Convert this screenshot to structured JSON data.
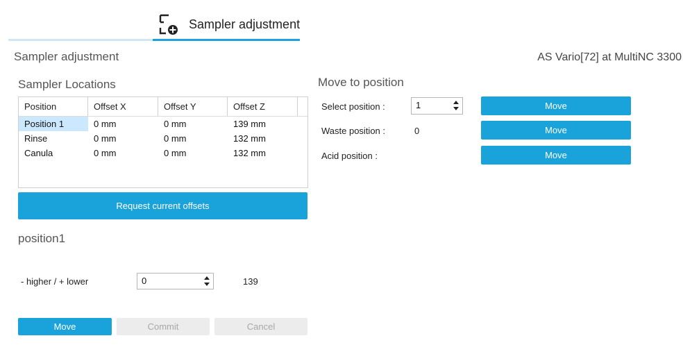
{
  "tab": {
    "label": "Sampler adjustment",
    "icon": "sampler-adjustment-icon"
  },
  "header": {
    "subtitle": "Sampler adjustment",
    "instrument": "AS Vario[72] at MultiNC 3300"
  },
  "locations": {
    "title": "Sampler Locations",
    "columns": [
      "Position",
      "Offset X",
      "Offset Y",
      "Offset Z"
    ],
    "rows": [
      {
        "position": "Position 1",
        "x": "0 mm",
        "y": "0 mm",
        "z": "139 mm"
      },
      {
        "position": "Rinse",
        "x": "0 mm",
        "y": "0 mm",
        "z": "132 mm"
      },
      {
        "position": "Canula",
        "x": "0 mm",
        "y": "0 mm",
        "z": "132 mm"
      }
    ],
    "selected_row": 0,
    "request_button": "Request current offsets"
  },
  "adjust": {
    "title": "position1",
    "label": "- higher / + lower",
    "value": "0",
    "current": "139",
    "move_button": "Move",
    "commit_button": "Commit",
    "cancel_button": "Cancel"
  },
  "move_to": {
    "title": "Move to position",
    "select_label": "Select position :",
    "select_value": "1",
    "waste_label": "Waste position :",
    "waste_value": "0",
    "acid_label": "Acid position :",
    "move_button": "Move"
  },
  "colors": {
    "accent": "#1aa3db",
    "selection": "#cce8ff",
    "disabled": "#ececec"
  }
}
